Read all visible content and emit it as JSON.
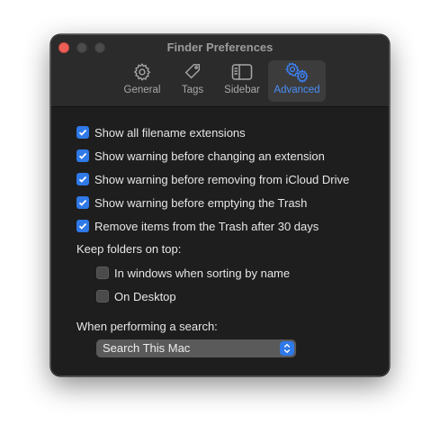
{
  "window": {
    "title": "Finder Preferences"
  },
  "tabs": [
    {
      "label": "General",
      "icon": "gear-icon"
    },
    {
      "label": "Tags",
      "icon": "tag-icon"
    },
    {
      "label": "Sidebar",
      "icon": "sidebar-icon"
    },
    {
      "label": "Advanced",
      "icon": "gears-icon",
      "active": true
    }
  ],
  "options": [
    {
      "label": "Show all filename extensions",
      "checked": true
    },
    {
      "label": "Show warning before changing an extension",
      "checked": true
    },
    {
      "label": "Show warning before removing from iCloud Drive",
      "checked": true
    },
    {
      "label": "Show warning before emptying the Trash",
      "checked": true
    },
    {
      "label": "Remove items from the Trash after 30 days",
      "checked": true
    }
  ],
  "folders_on_top": {
    "heading": "Keep folders on top:",
    "items": [
      {
        "label": "In windows when sorting by name",
        "checked": false
      },
      {
        "label": "On Desktop",
        "checked": false
      }
    ]
  },
  "search": {
    "heading": "When performing a search:",
    "selected": "Search This Mac"
  },
  "colors": {
    "accent": "#2f79e8",
    "background": "#1e1e1e",
    "close": "#ec5f57"
  }
}
